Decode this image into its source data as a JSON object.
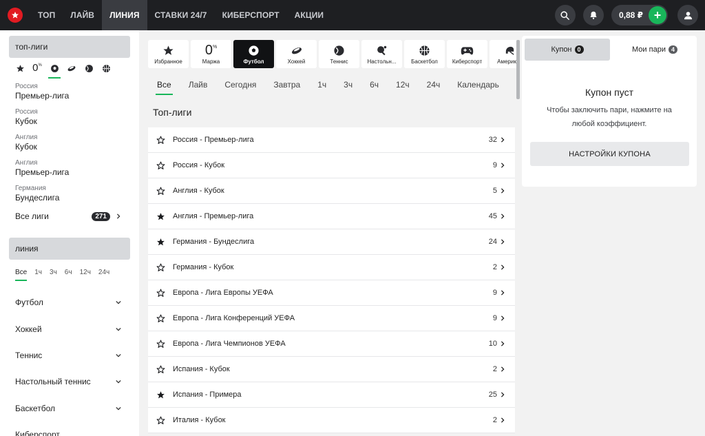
{
  "header": {
    "nav": [
      {
        "label": "ТОП",
        "active": false
      },
      {
        "label": "ЛАЙВ",
        "active": false
      },
      {
        "label": "ЛИНИЯ",
        "active": true
      },
      {
        "label": "СТАВКИ 24/7",
        "active": false
      },
      {
        "label": "КИБЕРСПОРТ",
        "active": false
      },
      {
        "label": "АКЦИИ",
        "active": false
      }
    ],
    "balance": "0,88 ₽"
  },
  "sidebar": {
    "top_leagues_header": "топ-лиги",
    "margin_icon_label": "0",
    "leagues": [
      {
        "country": "Россия",
        "name": "Премьер-лига"
      },
      {
        "country": "Россия",
        "name": "Кубок"
      },
      {
        "country": "Англия",
        "name": "Кубок"
      },
      {
        "country": "Англия",
        "name": "Премьер-лига"
      },
      {
        "country": "Германия",
        "name": "Бундеслига"
      }
    ],
    "all_leagues_label": "Все лиги",
    "all_leagues_count": "271",
    "line_header": "линия",
    "time_tabs": [
      "Все",
      "1ч",
      "3ч",
      "6ч",
      "12ч",
      "24ч"
    ],
    "sports": [
      "Футбол",
      "Хоккей",
      "Теннис",
      "Настольный теннис",
      "Баскетбол",
      "Киберспорт"
    ]
  },
  "main": {
    "sport_tiles": [
      {
        "label": "Избранное",
        "icon": "star-icon"
      },
      {
        "label": "Маржа",
        "icon": "margin-icon",
        "glyph": "0"
      },
      {
        "label": "Футбол",
        "icon": "football-icon",
        "active": true
      },
      {
        "label": "Хоккей",
        "icon": "hockey-icon"
      },
      {
        "label": "Теннис",
        "icon": "tennis-icon"
      },
      {
        "label": "Настольн...",
        "icon": "table-tennis-icon"
      },
      {
        "label": "Баскетбол",
        "icon": "basketball-icon"
      },
      {
        "label": "Киберспорт",
        "icon": "gamepad-icon"
      },
      {
        "label": "Американ",
        "icon": "american-football-icon"
      }
    ],
    "filter_tabs": [
      "Все",
      "Лайв",
      "Сегодня",
      "Завтра",
      "1ч",
      "3ч",
      "6ч",
      "12ч",
      "24ч",
      "Календарь"
    ],
    "section_title": "Топ-лиги",
    "leagues": [
      {
        "name": "Россия - Премьер-лига",
        "count": "32",
        "favorite": false
      },
      {
        "name": "Россия - Кубок",
        "count": "9",
        "favorite": false
      },
      {
        "name": "Англия - Кубок",
        "count": "5",
        "favorite": false
      },
      {
        "name": "Англия - Премьер-лига",
        "count": "45",
        "favorite": true
      },
      {
        "name": "Германия - Бундеслига",
        "count": "24",
        "favorite": true
      },
      {
        "name": "Германия - Кубок",
        "count": "2",
        "favorite": false
      },
      {
        "name": "Европа - Лига Европы УЕФА",
        "count": "9",
        "favorite": false
      },
      {
        "name": "Европа - Лига Конференций УЕФА",
        "count": "9",
        "favorite": false
      },
      {
        "name": "Европа - Лига Чемпионов УЕФА",
        "count": "10",
        "favorite": false
      },
      {
        "name": "Испания - Кубок",
        "count": "2",
        "favorite": false
      },
      {
        "name": "Испания - Примера",
        "count": "25",
        "favorite": true
      },
      {
        "name": "Италия - Кубок",
        "count": "2",
        "favorite": false
      }
    ]
  },
  "coupon": {
    "tab_coupon": "Купон",
    "tab_coupon_count": "0",
    "tab_my_bets": "Мои пари",
    "tab_my_bets_count": "4",
    "empty_title": "Купон пуст",
    "empty_text": "Чтобы заключить пари, нажмите на любой коэффициент.",
    "settings_button": "НАСТРОЙКИ КУПОНА"
  },
  "colors": {
    "accent": "#19b65a",
    "brand": "#e11b22",
    "topbar": "#1e1f22"
  }
}
